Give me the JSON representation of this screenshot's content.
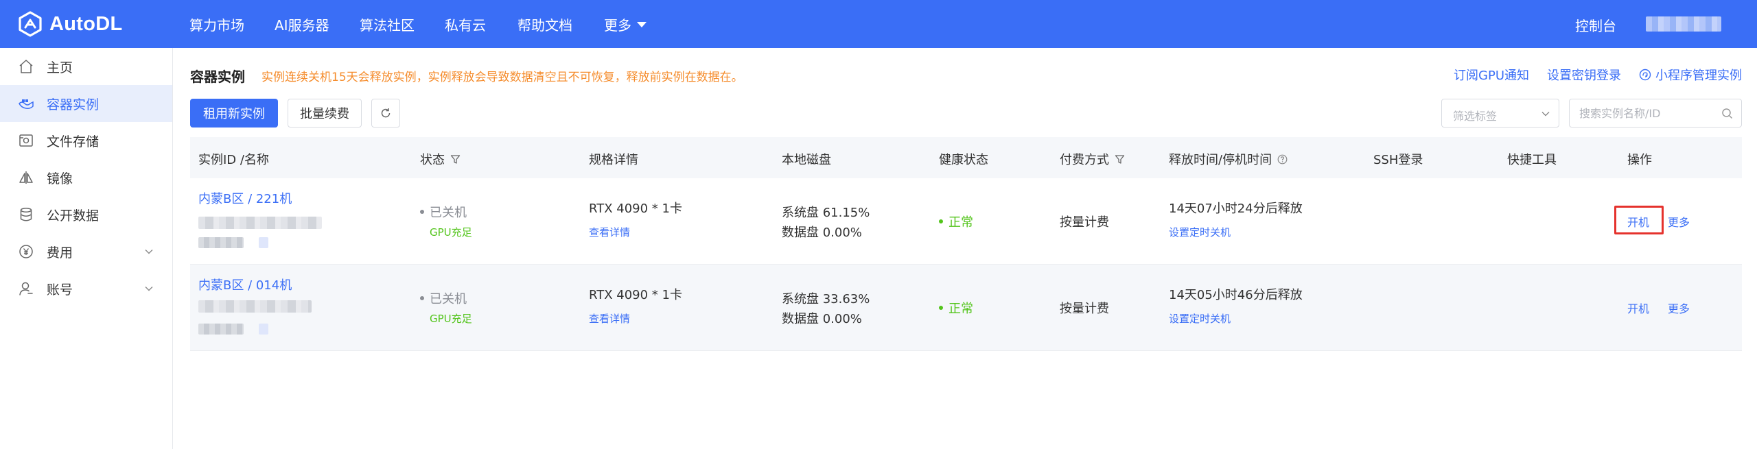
{
  "header": {
    "logo_text": "AutoDL",
    "nav": [
      {
        "label": "算力市场"
      },
      {
        "label": "AI服务器"
      },
      {
        "label": "算法社区"
      },
      {
        "label": "私有云"
      },
      {
        "label": "帮助文档"
      },
      {
        "label": "更多"
      }
    ],
    "console_label": "控制台",
    "accent_color": "#3a6ef6"
  },
  "sidebar": {
    "items": [
      {
        "label": "主页",
        "icon": "home-icon"
      },
      {
        "label": "容器实例",
        "icon": "container-icon",
        "active": true
      },
      {
        "label": "文件存储",
        "icon": "storage-icon"
      },
      {
        "label": "镜像",
        "icon": "image-icon"
      },
      {
        "label": "公开数据",
        "icon": "database-icon"
      },
      {
        "label": "费用",
        "icon": "yen-icon",
        "expandable": true
      },
      {
        "label": "账号",
        "icon": "user-icon",
        "expandable": true
      }
    ]
  },
  "main": {
    "title": "容器实例",
    "warning": "实例连续关机15天会释放实例，实例释放会导致数据清空且不可恢复，释放前实例在数据在。",
    "warning_color": "#f58c2c",
    "links": {
      "gpu_notify": "订阅GPU通知",
      "ssh_key": "设置密钥登录",
      "miniprogram": "小程序管理实例"
    },
    "buttons": {
      "rent": "租用新实例",
      "renew": "批量续费"
    },
    "filter": {
      "placeholder": "筛选标签"
    },
    "search": {
      "placeholder": "搜索实例名称/ID"
    }
  },
  "table": {
    "headers": {
      "id_name": "实例ID /名称",
      "status": "状态",
      "spec": "规格详情",
      "disk": "本地磁盘",
      "health": "健康状态",
      "billing": "付费方式",
      "release": "释放时间/停机时间",
      "ssh": "SSH登录",
      "tools": "快捷工具",
      "ops": "操作"
    },
    "rows": [
      {
        "name": "内蒙B区 / 221机",
        "status": "已关机",
        "status_sub": "GPU充足",
        "spec": "RTX 4090 * 1卡",
        "spec_link": "查看详情",
        "sys_disk": "系统盘 61.15%",
        "data_disk": "数据盘 0.00%",
        "health": "正常",
        "billing": "按量计费",
        "release": "14天07小时24分后释放",
        "release_link": "设置定时关机",
        "op_start": "开机",
        "op_more": "更多",
        "highlighted": true
      },
      {
        "name": "内蒙B区 / 014机",
        "status": "已关机",
        "status_sub": "GPU充足",
        "spec": "RTX 4090 * 1卡",
        "spec_link": "查看详情",
        "sys_disk": "系统盘 33.63%",
        "data_disk": "数据盘 0.00%",
        "health": "正常",
        "billing": "按量计费",
        "release": "14天05小时46分后释放",
        "release_link": "设置定时关机",
        "op_start": "开机",
        "op_more": "更多",
        "highlighted": false
      }
    ]
  }
}
